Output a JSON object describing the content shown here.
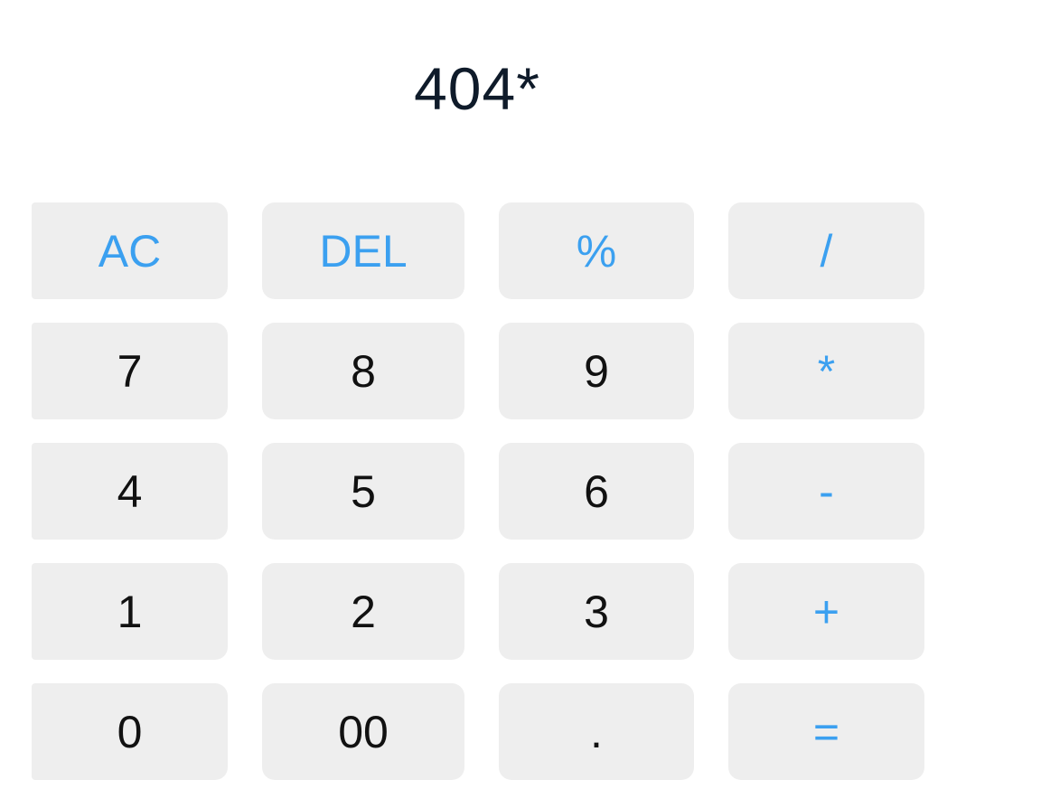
{
  "display": {
    "value": "404*"
  },
  "keys": {
    "ac": "AC",
    "del": "DEL",
    "percent": "%",
    "divide": "/",
    "seven": "7",
    "eight": "8",
    "nine": "9",
    "multiply": "*",
    "four": "4",
    "five": "5",
    "six": "6",
    "subtract": "-",
    "one": "1",
    "two": "2",
    "three": "3",
    "add": "+",
    "zero": "0",
    "double_zero": "00",
    "decimal": ".",
    "equals": "="
  },
  "colors": {
    "accent": "#3ba0f0",
    "key_background": "#eeeeee",
    "digit_text": "#111111",
    "display_text": "#0f1b2a"
  }
}
